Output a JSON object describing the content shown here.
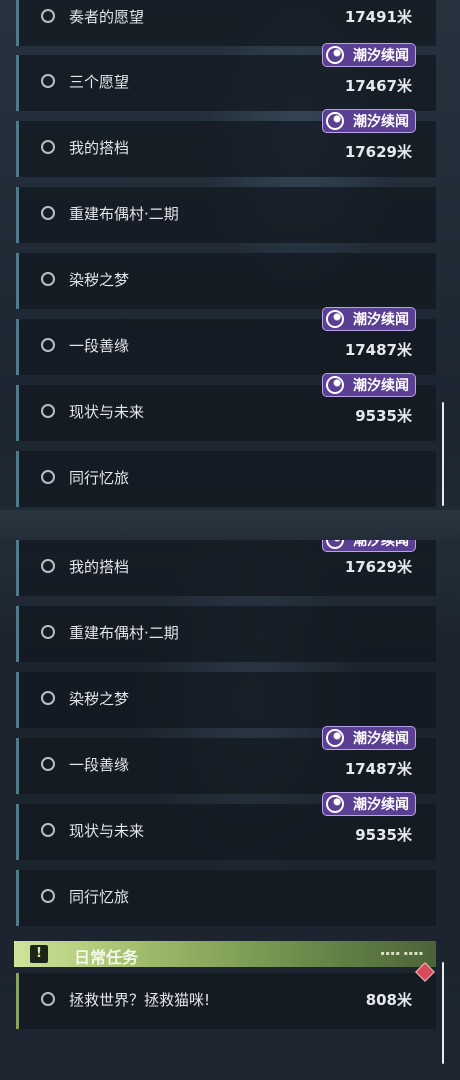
{
  "colors": {
    "row_accent": "#4f7a8c",
    "badge_bg": "#5b3f93",
    "daily_accent": "#9fbd6b",
    "daily_marker": "#d8495a"
  },
  "top_list": [
    {
      "label": "奏者的愿望",
      "distance": "17491米",
      "badge": ""
    },
    {
      "label": "三个愿望",
      "distance": "17467米",
      "badge": "潮汐续闻"
    },
    {
      "label": "我的搭档",
      "distance": "17629米",
      "badge": "潮汐续闻"
    },
    {
      "label": "重建布偶村·二期",
      "distance": "",
      "badge": ""
    },
    {
      "label": "染秽之梦",
      "distance": "",
      "badge": ""
    },
    {
      "label": "一段善缘",
      "distance": "17487米",
      "badge": "潮汐续闻"
    },
    {
      "label": "现状与未来",
      "distance": "9535米",
      "badge": "潮汐续闻"
    },
    {
      "label": "同行忆旅",
      "distance": "",
      "badge": ""
    }
  ],
  "bottom_list": [
    {
      "label": "我的搭档",
      "distance": "17629米",
      "badge": "潮汐续闻"
    },
    {
      "label": "重建布偶村·二期",
      "distance": "",
      "badge": ""
    },
    {
      "label": "染秽之梦",
      "distance": "",
      "badge": ""
    },
    {
      "label": "一段善缘",
      "distance": "17487米",
      "badge": "潮汐续闻"
    },
    {
      "label": "现状与未来",
      "distance": "9535米",
      "badge": "潮汐续闻"
    },
    {
      "label": "同行忆旅",
      "distance": "",
      "badge": ""
    }
  ],
  "daily": {
    "header_icon": "exclamation-icon",
    "title": "日常任务",
    "tasks": [
      {
        "label": "拯救世界？拯救猫咪!",
        "distance": "808米"
      }
    ]
  }
}
